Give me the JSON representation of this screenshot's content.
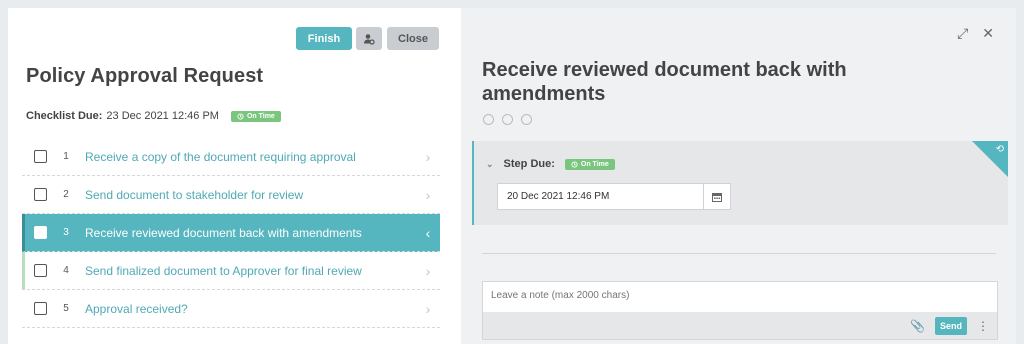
{
  "toolbar": {
    "finish_label": "Finish",
    "close_label": "Close"
  },
  "checklist": {
    "title": "Policy Approval Request",
    "due_label": "Checklist Due:",
    "due_value": "23 Dec 2021 12:46 PM",
    "status": "On Time",
    "items": [
      {
        "num": "1",
        "label": "Receive a copy of the document requiring approval"
      },
      {
        "num": "2",
        "label": "Send document to stakeholder for review"
      },
      {
        "num": "3",
        "label": "Receive reviewed document back with amendments"
      },
      {
        "num": "4",
        "label": "Send finalized document to Approver for final review"
      },
      {
        "num": "5",
        "label": "Approval received?"
      }
    ]
  },
  "step": {
    "title": "Receive reviewed document back with amendments",
    "due_label": "Step Due:",
    "status": "On Time",
    "due_value": "20 Dec 2021 12:46 PM"
  },
  "note": {
    "placeholder": "Leave a note (max 2000 chars)",
    "send_label": "Send"
  },
  "colors": {
    "accent": "#55b6bf",
    "status_green": "#7bc67e"
  }
}
